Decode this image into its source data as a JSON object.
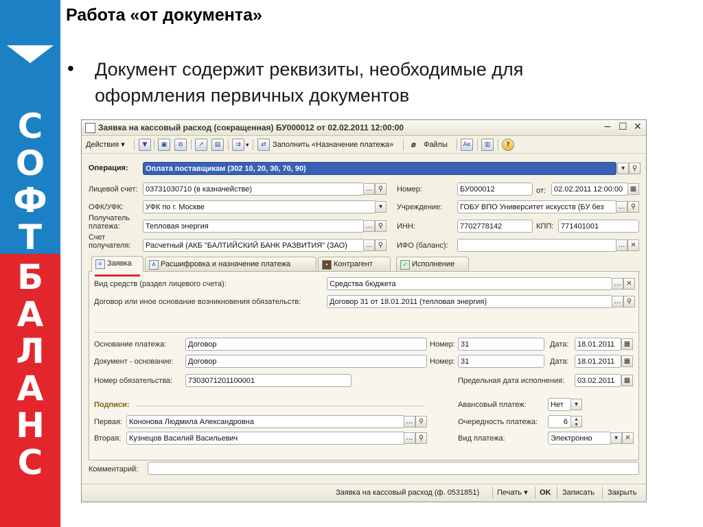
{
  "slide": {
    "title": "Работа «от документа»",
    "bullet": "•",
    "bullet_text": "Документ содержит реквизиты, необходимые для оформления первичных документов",
    "brand_letters": [
      "С",
      "О",
      "Ф",
      "Т",
      "Б",
      "А",
      "Л",
      "А",
      "Н",
      "С"
    ],
    "colors": {
      "brand_blue": "#1c80c4",
      "brand_red": "#e3262b"
    }
  },
  "window": {
    "title": "Заявка на кассовый расход (сокращенная) БУ000012 от 02.02.2011 12:00:00",
    "controls": {
      "minimize": "−",
      "maximize": "☐",
      "close": "✕"
    }
  },
  "toolbar": {
    "actions": "Действия ▾",
    "fill": "Заполнить «Назначение платежа»",
    "files": "Файлы",
    "help": "?"
  },
  "header": {
    "operation_label": "Операция:",
    "operation_value": "Оплата поставщикам (302 10, 20, 30, 70, 90)",
    "account_label": "Лицевой счет:",
    "account_value": "03731030710 (в казначействе)",
    "number_label": "Номер:",
    "number_value": "БУ000012",
    "from_label": "от:",
    "date_value": "02.02.2011 12:00:00",
    "ofk_label": "ОФК/УФК:",
    "ofk_value": "УФК по г. Москве",
    "institution_label": "Учреждение:",
    "institution_value": "ГОБУ ВПО Университет искусств (БУ без",
    "payee_label_1": "Получатель",
    "payee_label_2": "платежа:",
    "payee_value": "Тепловая энергия",
    "inn_label": "ИНН:",
    "inn_value": "7702778142",
    "kpp_label": "КПП:",
    "kpp_value": "771401001",
    "payee_account_label_1": "Счет",
    "payee_account_label_2": "получателя:",
    "payee_account_value": "Расчетный (АКБ \"БАЛТИЙСКИЙ БАНК РАЗВИТИЯ\" (ЗАО)",
    "ifo_label": "ИФО (баланс):",
    "ifo_value": ""
  },
  "tabs": [
    {
      "label": "Заявка",
      "active": true
    },
    {
      "label": "Расшифровка и назначение платежа",
      "active": false
    },
    {
      "label": "Контрагент",
      "active": false
    },
    {
      "label": "Исполнение",
      "active": false
    }
  ],
  "request": {
    "funds_label": "Вид средств (раздел лицевого счета):",
    "funds_value": "Средства бюджета",
    "contract_label": "Договор или иное основание возникновения обязательств:",
    "contract_value": "Договор 31 от 18.01.2011 (тепловая энергия)",
    "basis_label": "Основание платежа:",
    "basis_value": "Договор",
    "basis_number_label": "Номер:",
    "basis_number_value": "31",
    "basis_date_label": "Дата:",
    "basis_date_value": "18.01.2011",
    "doc_label": "Документ - основание:",
    "doc_value": "Договор",
    "doc_number_label": "Номер:",
    "doc_number_value": "31",
    "doc_date_label": "Дата:",
    "doc_date_value": "18.01.2011",
    "obligation_label": "Номер обязательства:",
    "obligation_value": "7303071201100001",
    "deadline_label": "Предельная дата исполнения:",
    "deadline_value": "03.02.2011",
    "signatures_label": "Подписи:",
    "first_label": "Первая:",
    "first_value": "Кононова Людмила Александровна",
    "second_label": "Вторая:",
    "second_value": "Кузнецов Василий Васильевич",
    "advance_label": "Авансовый платеж:",
    "advance_value": "Нет",
    "priority_label": "Очередность платежа:",
    "priority_value": "6",
    "payment_type_label": "Вид платежа:",
    "payment_type_value": "Электронно"
  },
  "comment": {
    "label": "Комментарий:",
    "value": ""
  },
  "statusbar": {
    "form": "Заявка на кассовый расход (ф. 0531851)",
    "print": "Печать ▾",
    "ok": "OK",
    "save": "Записать",
    "close": "Закрыть"
  }
}
